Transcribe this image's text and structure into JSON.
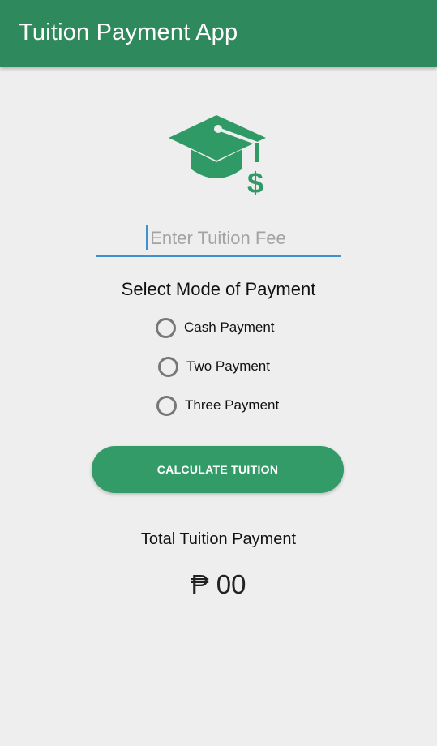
{
  "app_bar": {
    "title": "Tuition Payment App",
    "color": "#2e8a5c"
  },
  "logo": {
    "icon": "graduation-cap-dollar-icon",
    "color": "#2f9a66"
  },
  "fee_input": {
    "placeholder": "Enter Tuition Fee",
    "value": ""
  },
  "payment_section": {
    "title": "Select Mode of Payment",
    "options": [
      {
        "label": "Cash Payment",
        "selected": false
      },
      {
        "label": "Two Payment",
        "selected": false
      },
      {
        "label": "Three Payment",
        "selected": false
      }
    ]
  },
  "calculate_button": {
    "label": "CALCULATE TUITION",
    "color": "#339b67"
  },
  "total": {
    "label": "Total Tuition Payment",
    "value": "₱ 00"
  }
}
